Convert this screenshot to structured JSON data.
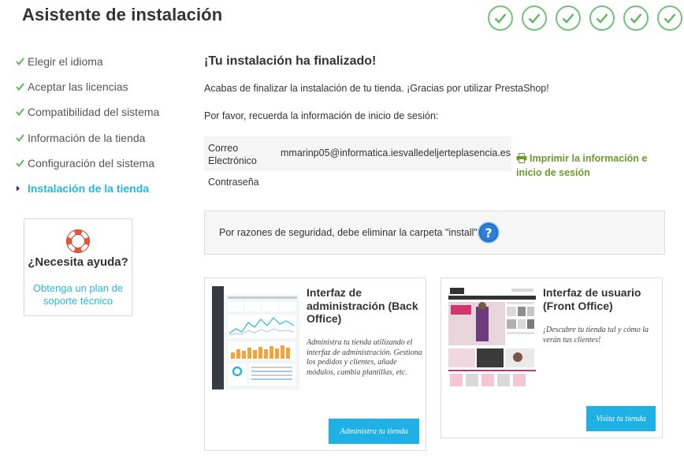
{
  "header": {
    "title": "Asistente de instalación",
    "progress_total": 6,
    "progress_done": 6
  },
  "sidebar": {
    "items": [
      {
        "label": "Elegir el idioma",
        "state": "done"
      },
      {
        "label": "Aceptar las licencias",
        "state": "done"
      },
      {
        "label": "Compatibilidad del sistema",
        "state": "done"
      },
      {
        "label": "Información de la tienda",
        "state": "done"
      },
      {
        "label": "Configuración del sistema",
        "state": "done"
      },
      {
        "label": "Instalación de la tienda",
        "state": "active"
      }
    ]
  },
  "help": {
    "title": "¿Necesita ayuda?",
    "link": "Obtenga un plan de soporte técnico"
  },
  "main": {
    "title": "¡Tu instalación ha finalizado!",
    "intro": "Acabas de finalizar la instalación de tu tienda. ¡Gracias por utilizar PrestaShop!",
    "reminder": "Por favor, recuerda la información de inicio de sesión:",
    "credentials": {
      "email_label": "Correo Electrónico",
      "email_value": "mmarinp05@informatica.iesvalledeljerteplasencia.es",
      "password_label": "Contraseña"
    },
    "print_link": "Imprimir la información e inicio de sesión",
    "security_notice": "Por razones de seguridad, debe eliminar la carpeta \"install\"."
  },
  "cards": {
    "admin": {
      "title": "Interfaz de administración (Back Office)",
      "description": "Administra tu tienda utilizando el interfaz de administración. Gestiona los pedidos y clientes, añade módulos, cambia plantillas, etc.",
      "button": "Administra tu tienda"
    },
    "front": {
      "title": "Interfaz de usuario (Front Office)",
      "description": "¡Descubre tu tienda tal y cómo la verán tus clientes!",
      "button": "Visita tu tienda"
    }
  },
  "colors": {
    "accent": "#25b9d7",
    "check": "#72c279",
    "button": "#1fb0e6",
    "print": "#6c9a2e"
  }
}
